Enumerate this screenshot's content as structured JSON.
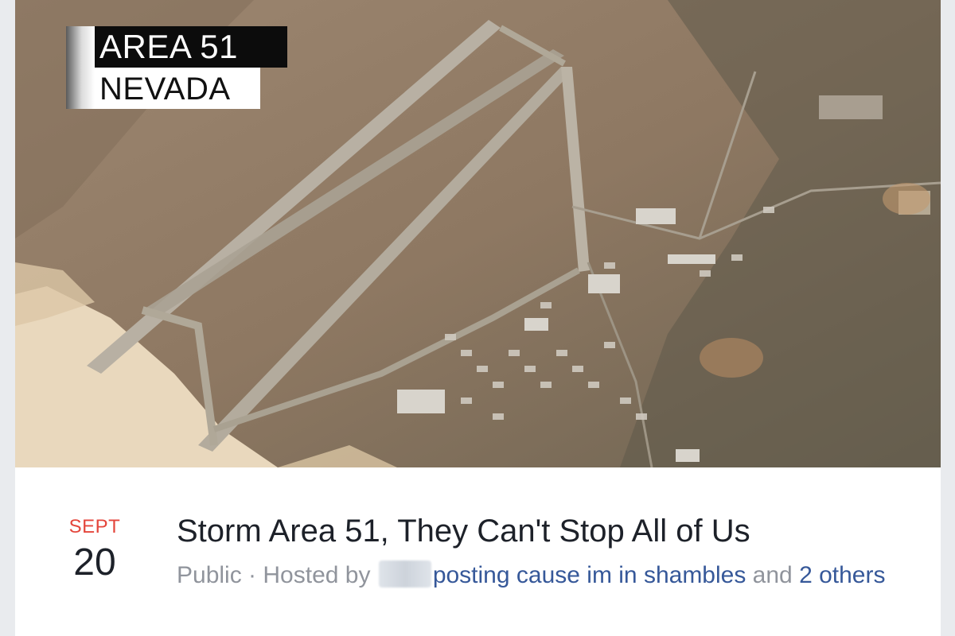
{
  "cover": {
    "overlay_line1": "AREA 51",
    "overlay_line2": "NEVADA"
  },
  "event": {
    "month": "SEPT",
    "day": "20",
    "title": "Storm Area 51, They Can't Stop All of Us",
    "privacy": "Public",
    "separator": " · ",
    "hosted_by_label": "Hosted by",
    "host_name": "posting cause im in shambles",
    "and_label": " and ",
    "others_count_label": "2 others"
  },
  "colors": {
    "month_red": "#e4463c",
    "link_blue": "#365899",
    "meta_gray": "#90949c",
    "title_dark": "#1d2129"
  }
}
